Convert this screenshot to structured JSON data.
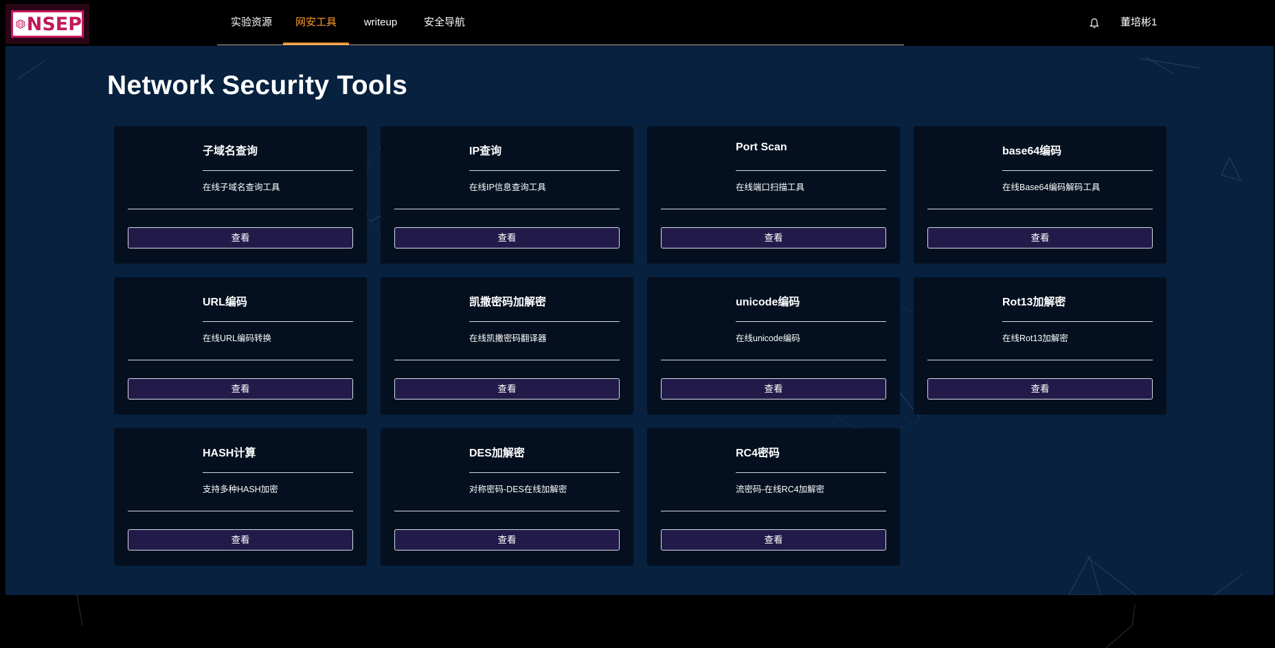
{
  "logo": {
    "text": "NSEP",
    "brand_color": "#c2185b"
  },
  "nav": {
    "items": [
      {
        "label": "实验资源",
        "active": false
      },
      {
        "label": "网安工具",
        "active": true
      },
      {
        "label": "writeup",
        "active": false
      },
      {
        "label": "安全导航",
        "active": false
      }
    ],
    "active_color": "#ff9a2e"
  },
  "header": {
    "bell_icon": "bell-icon",
    "username": "董培彬1"
  },
  "main": {
    "title": "Network Security Tools",
    "background": "#07213f",
    "cards": [
      {
        "title": "子域名查询",
        "desc": "在线子域名查询工具",
        "button": "查看"
      },
      {
        "title": "IP查询",
        "desc": "在线IP信息查询工具",
        "button": "查看"
      },
      {
        "title": "Port Scan",
        "desc": "在线端口扫描工具",
        "button": "查看"
      },
      {
        "title": "base64编码",
        "desc": "在线Base64编码解码工具",
        "button": "查看"
      },
      {
        "title": "URL编码",
        "desc": "在线URL编码转换",
        "button": "查看"
      },
      {
        "title": "凯撒密码加解密",
        "desc": "在线凯撒密码翻译器",
        "button": "查看"
      },
      {
        "title": "unicode编码",
        "desc": "在线unicode编码",
        "button": "查看"
      },
      {
        "title": "Rot13加解密",
        "desc": "在线Rot13加解密",
        "button": "查看"
      },
      {
        "title": "HASH计算",
        "desc": "支持多种HASH加密",
        "button": "查看"
      },
      {
        "title": "DES加解密",
        "desc": "对称密码-DES在线加解密",
        "button": "查看"
      },
      {
        "title": "RC4密码",
        "desc": "流密码-在线RC4加解密",
        "button": "查看"
      }
    ]
  }
}
